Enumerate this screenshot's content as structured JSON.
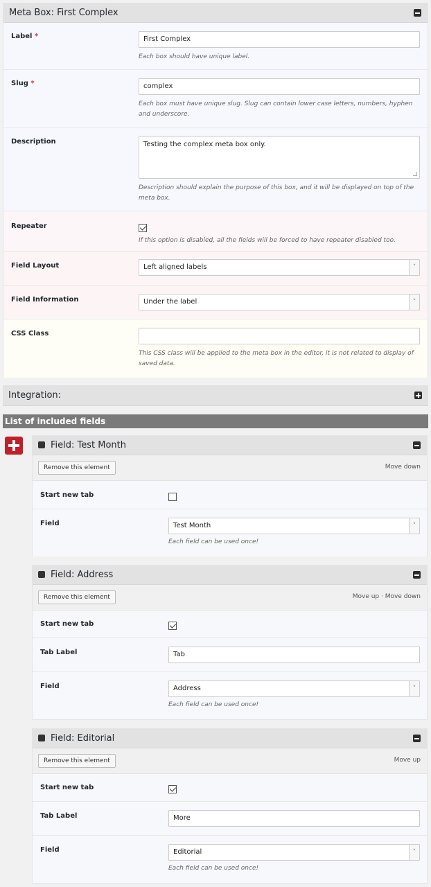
{
  "meta_box": {
    "title": "Meta Box: First Complex",
    "label_field": {
      "label": "Label",
      "required_mark": "*",
      "value": "First Complex",
      "help": "Each box should have unique label."
    },
    "slug_field": {
      "label": "Slug",
      "required_mark": "*",
      "value": "complex",
      "help_line1": "Each box must have unique slug. Slug can contain lower case letters, numbers, hyphen",
      "help_line2": "and underscore."
    },
    "description_field": {
      "label": "Description",
      "value": "Testing the complex meta box only.",
      "help_line1": "Description should explain the purpose of this box, and it will be displayed on top of the",
      "help_line2": "meta box."
    },
    "repeater_field": {
      "label": "Repeater",
      "checked": true,
      "help": "If this option is disabled, all the fields will be forced to have repeater disabled too."
    },
    "field_layout": {
      "label": "Field Layout",
      "value": "Left aligned labels"
    },
    "field_information": {
      "label": "Field Information",
      "value": "Under the label"
    },
    "css_class": {
      "label": "CSS Class",
      "value": "",
      "help_line1": "This CSS class will be applied to the meta box in the editor, it is not related to display of",
      "help_line2": "saved data."
    }
  },
  "integration": {
    "title": "Integration:"
  },
  "fields_section": {
    "title": "List of included fields"
  },
  "fields": [
    {
      "title": "Field: Test Month",
      "remove_label": "Remove this element",
      "move_links": "Move down",
      "start_new_tab_label": "Start new tab",
      "start_new_tab_checked": false,
      "field_label": "Field",
      "field_value": "Test Month",
      "field_help": "Each field can be used once!"
    },
    {
      "title": "Field: Address",
      "remove_label": "Remove this element",
      "move_links": "Move up · Move down",
      "start_new_tab_label": "Start new tab",
      "start_new_tab_checked": true,
      "tab_label_label": "Tab Label",
      "tab_label_value": "Tab",
      "field_label": "Field",
      "field_value": "Address",
      "field_help": "Each field can be used once!"
    },
    {
      "title": "Field: Editorial",
      "remove_label": "Remove this element",
      "move_links": "Move up",
      "start_new_tab_label": "Start new tab",
      "start_new_tab_checked": true,
      "tab_label_label": "Tab Label",
      "tab_label_value": "More",
      "field_label": "Field",
      "field_value": "Editorial",
      "field_help": "Each field can be used once!"
    }
  ]
}
